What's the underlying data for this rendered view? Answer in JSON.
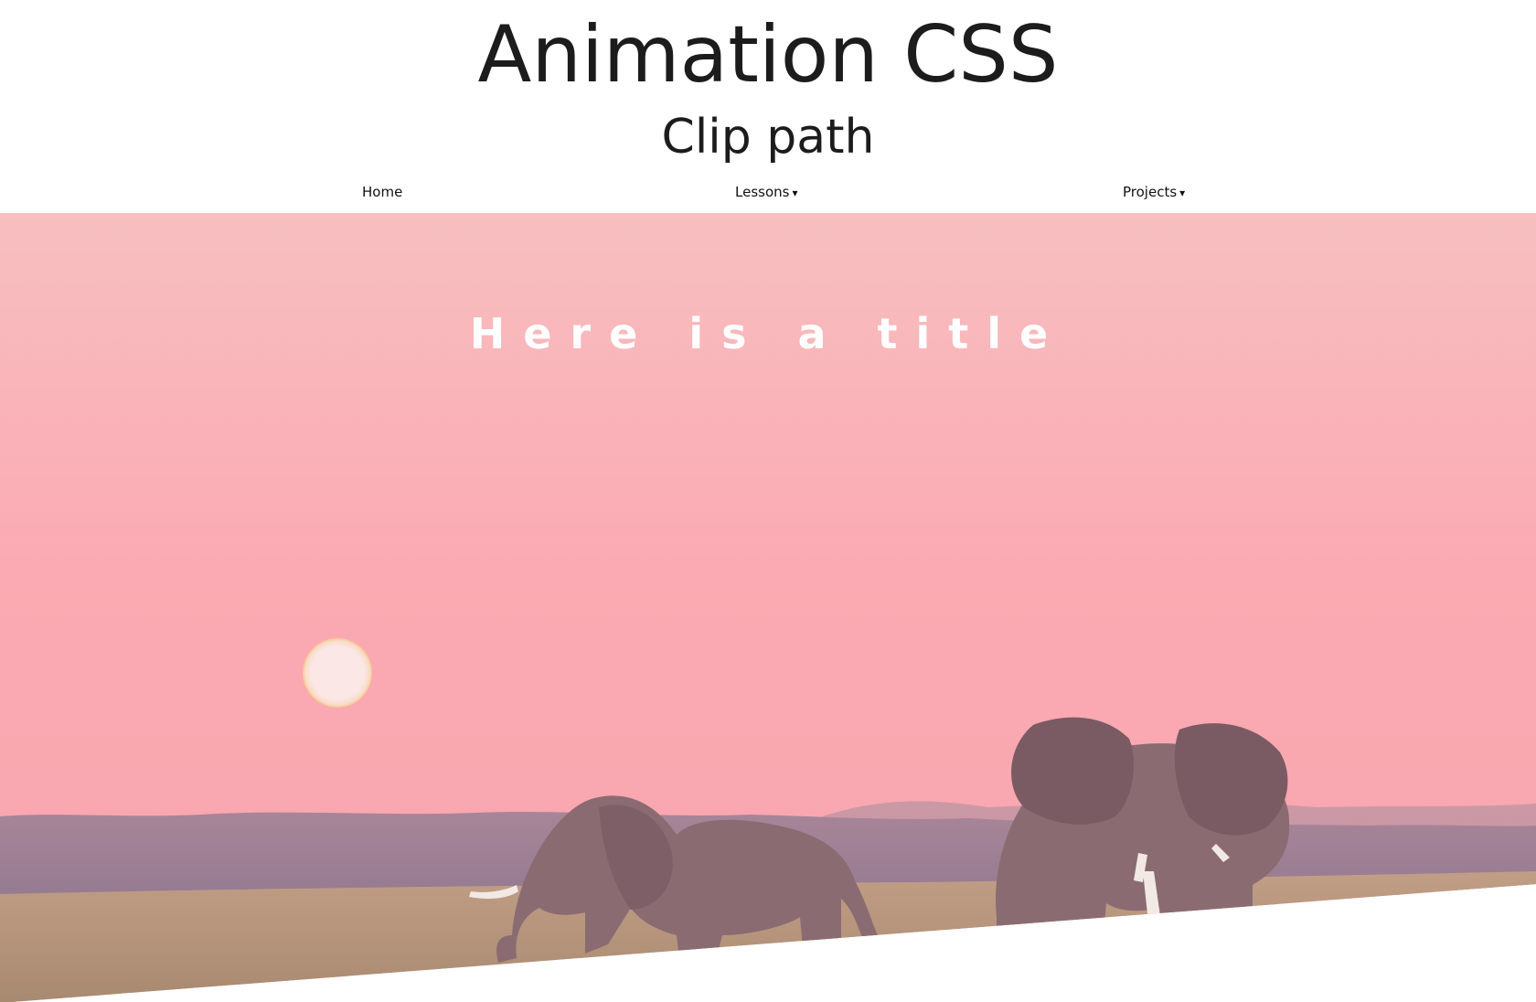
{
  "header": {
    "title": "Animation CSS",
    "subtitle": "Clip path"
  },
  "nav": {
    "home": "Home",
    "lessons": "Lessons",
    "projects": "Projects",
    "caret_glyph": "▾"
  },
  "hero": {
    "title": "Here is a title",
    "colors": {
      "sky_top": "#f7bfc0",
      "sky_mid": "#fbaab3",
      "sky_low": "#f7a4ad",
      "sun": "#fbe8e6",
      "sun_rim": "#f6c98a",
      "treeline": "#9a8296",
      "grass": "#b39580",
      "elephant": "#8b6b72"
    }
  }
}
